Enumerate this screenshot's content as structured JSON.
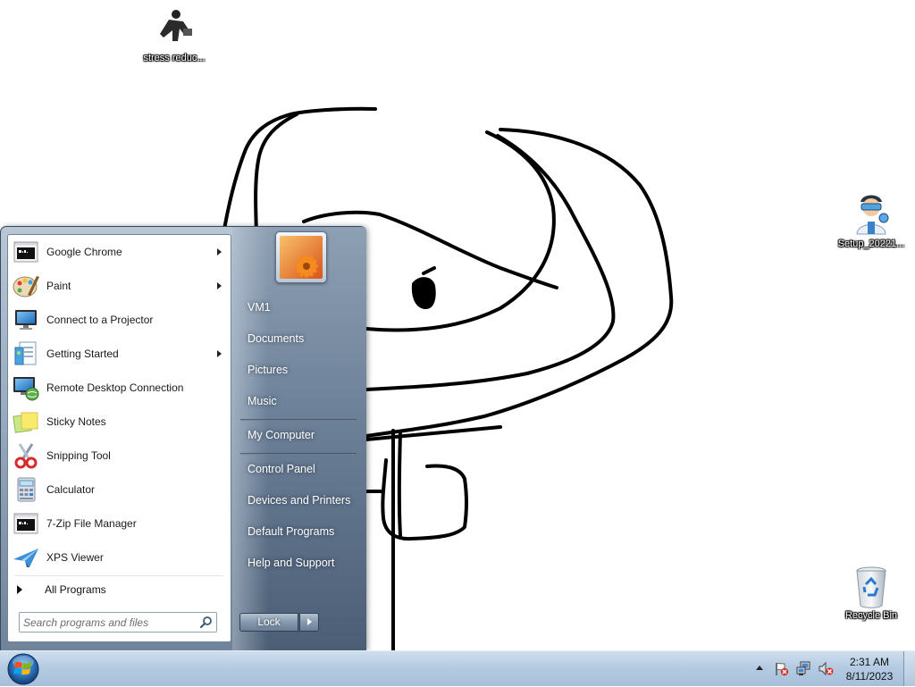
{
  "desktop": {
    "icons": [
      {
        "label": "stress reduc...",
        "icon": "person-figure-icon"
      },
      {
        "label": "Setup_20221...",
        "icon": "setup-person-icon"
      },
      {
        "label": "Recycle Bin",
        "icon": "recycle-bin-icon"
      }
    ]
  },
  "start_menu": {
    "programs": [
      {
        "label": "Google Chrome",
        "icon": "console-icon",
        "has_submenu": true
      },
      {
        "label": "Paint",
        "icon": "paint-palette-icon",
        "has_submenu": true
      },
      {
        "label": "Connect to a Projector",
        "icon": "projector-monitor-icon",
        "has_submenu": false
      },
      {
        "label": "Getting Started",
        "icon": "getting-started-icon",
        "has_submenu": true
      },
      {
        "label": "Remote Desktop Connection",
        "icon": "remote-desktop-icon",
        "has_submenu": false
      },
      {
        "label": "Sticky Notes",
        "icon": "sticky-notes-icon",
        "has_submenu": false
      },
      {
        "label": "Snipping Tool",
        "icon": "scissors-icon",
        "has_submenu": false
      },
      {
        "label": "Calculator",
        "icon": "calculator-icon",
        "has_submenu": false
      },
      {
        "label": "7-Zip File Manager",
        "icon": "console-icon",
        "has_submenu": false
      },
      {
        "label": "XPS Viewer",
        "icon": "paper-plane-icon",
        "has_submenu": false
      }
    ],
    "all_programs": "All Programs",
    "search_placeholder": "Search programs and files",
    "places": [
      {
        "label": "VM1"
      },
      {
        "label": "Documents"
      },
      {
        "label": "Pictures"
      },
      {
        "label": "Music"
      },
      {
        "label": "My Computer"
      },
      {
        "label": "Control Panel"
      },
      {
        "label": "Devices and Printers"
      },
      {
        "label": "Default Programs"
      },
      {
        "label": "Help and Support"
      }
    ],
    "lock_label": "Lock"
  },
  "taskbar": {
    "time": "2:31 AM",
    "date": "8/11/2023",
    "tray_icons": [
      "show-hidden-icons",
      "action-center-flag-icon",
      "network-icon",
      "volume-muted-icon"
    ]
  }
}
